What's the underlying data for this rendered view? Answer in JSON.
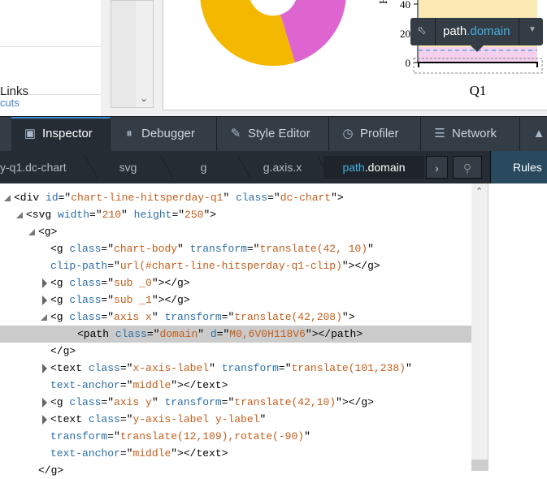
{
  "page": {
    "links_label": "Links",
    "shortcuts_label": "cuts",
    "chart": {
      "y_ticks": [
        "40",
        "20",
        "0"
      ],
      "x_label": "Q1",
      "y_label_fragment": "H"
    },
    "highlighter": {
      "tag": "path",
      "class": ".domain"
    }
  },
  "toolbar": {
    "tabs": [
      {
        "label": "Inspector",
        "icon": "inspector-icon",
        "selected": true
      },
      {
        "label": "Debugger",
        "icon": "pause-icon"
      },
      {
        "label": "Style Editor",
        "icon": "edit-icon"
      },
      {
        "label": "Profiler",
        "icon": "gauge-icon"
      },
      {
        "label": "Network",
        "icon": "network-icon"
      }
    ]
  },
  "breadcrumbs": [
    {
      "label": "y-q1.dc-chart"
    },
    {
      "label": "svg"
    },
    {
      "label": "g"
    },
    {
      "label": "g.axis.x"
    },
    {
      "tag": "path",
      "class": ".domain",
      "selected": true
    }
  ],
  "sidebar": {
    "rules_tab": "Rules"
  },
  "markup": {
    "lines": [
      {
        "indent": 0,
        "twisty": "open",
        "parts": [
          [
            "t",
            "<div "
          ],
          [
            "a",
            "id"
          ],
          [
            "t",
            "=\""
          ],
          [
            "v",
            "chart-line-hitsperday-q1"
          ],
          [
            "t",
            "\" "
          ],
          [
            "a",
            "class"
          ],
          [
            "t",
            "=\""
          ],
          [
            "v",
            "dc-chart"
          ],
          [
            "t",
            "\">"
          ]
        ]
      },
      {
        "indent": 1,
        "twisty": "open",
        "parts": [
          [
            "t",
            "<svg "
          ],
          [
            "a",
            "width"
          ],
          [
            "t",
            "=\""
          ],
          [
            "v",
            "210"
          ],
          [
            "t",
            "\" "
          ],
          [
            "a",
            "height"
          ],
          [
            "t",
            "=\""
          ],
          [
            "v",
            "250"
          ],
          [
            "t",
            "\">"
          ]
        ]
      },
      {
        "indent": 2,
        "twisty": "open",
        "parts": [
          [
            "t",
            "<g>"
          ]
        ]
      },
      {
        "indent": 3,
        "parts": [
          [
            "t",
            "<g "
          ],
          [
            "a",
            "class"
          ],
          [
            "t",
            "=\""
          ],
          [
            "v",
            "chart-body"
          ],
          [
            "t",
            "\" "
          ],
          [
            "a",
            "transform"
          ],
          [
            "t",
            "=\""
          ],
          [
            "v",
            "translate(42, 10)"
          ],
          [
            "t",
            "\""
          ]
        ]
      },
      {
        "indent": 3,
        "parts": [
          [
            "a",
            "clip-path"
          ],
          [
            "t",
            "=\""
          ],
          [
            "v",
            "url(#chart-line-hitsperday-q1-clip)"
          ],
          [
            "t",
            "\"></g>"
          ]
        ]
      },
      {
        "indent": 3,
        "twisty": "closed",
        "parts": [
          [
            "t",
            "<g "
          ],
          [
            "a",
            "class"
          ],
          [
            "t",
            "=\""
          ],
          [
            "v",
            "sub _0"
          ],
          [
            "t",
            "\"></g>"
          ]
        ]
      },
      {
        "indent": 3,
        "twisty": "closed",
        "parts": [
          [
            "t",
            "<g "
          ],
          [
            "a",
            "class"
          ],
          [
            "t",
            "=\""
          ],
          [
            "v",
            "sub _1"
          ],
          [
            "t",
            "\"></g>"
          ]
        ]
      },
      {
        "indent": 3,
        "twisty": "open",
        "parts": [
          [
            "t",
            "<g "
          ],
          [
            "a",
            "class"
          ],
          [
            "t",
            "=\""
          ],
          [
            "v",
            "axis x"
          ],
          [
            "t",
            "\" "
          ],
          [
            "a",
            "transform"
          ],
          [
            "t",
            "=\""
          ],
          [
            "v",
            "translate(42,208)"
          ],
          [
            "t",
            "\">"
          ]
        ]
      },
      {
        "indent": 4,
        "selected": true,
        "parts": [
          [
            "t",
            "<path "
          ],
          [
            "a",
            "class"
          ],
          [
            "t",
            "=\""
          ],
          [
            "v",
            "domain"
          ],
          [
            "t",
            "\" "
          ],
          [
            "a",
            "d"
          ],
          [
            "t",
            "=\""
          ],
          [
            "v",
            "M0,6V0H118V6"
          ],
          [
            "t",
            "\"></path>"
          ]
        ]
      },
      {
        "indent": 3,
        "parts": [
          [
            "t",
            "</g>"
          ]
        ]
      },
      {
        "indent": 3,
        "twisty": "closed",
        "parts": [
          [
            "t",
            "<text "
          ],
          [
            "a",
            "class"
          ],
          [
            "t",
            "=\""
          ],
          [
            "v",
            "x-axis-label"
          ],
          [
            "t",
            "\" "
          ],
          [
            "a",
            "transform"
          ],
          [
            "t",
            "=\""
          ],
          [
            "v",
            "translate(101,238)"
          ],
          [
            "t",
            "\""
          ]
        ]
      },
      {
        "indent": 3,
        "parts": [
          [
            "a",
            "text-anchor"
          ],
          [
            "t",
            "=\""
          ],
          [
            "v",
            "middle"
          ],
          [
            "t",
            "\"></text>"
          ]
        ]
      },
      {
        "indent": 3,
        "twisty": "closed",
        "parts": [
          [
            "t",
            "<g "
          ],
          [
            "a",
            "class"
          ],
          [
            "t",
            "=\""
          ],
          [
            "v",
            "axis y"
          ],
          [
            "t",
            "\" "
          ],
          [
            "a",
            "transform"
          ],
          [
            "t",
            "=\""
          ],
          [
            "v",
            "translate(42,10)"
          ],
          [
            "t",
            "\"></g>"
          ]
        ]
      },
      {
        "indent": 3,
        "twisty": "closed",
        "parts": [
          [
            "t",
            "<text "
          ],
          [
            "a",
            "class"
          ],
          [
            "t",
            "=\""
          ],
          [
            "v",
            "y-axis-label y-label"
          ],
          [
            "t",
            "\""
          ]
        ]
      },
      {
        "indent": 3,
        "parts": [
          [
            "a",
            "transform"
          ],
          [
            "t",
            "=\""
          ],
          [
            "v",
            "translate(12,109),rotate(-90)"
          ],
          [
            "t",
            "\""
          ]
        ]
      },
      {
        "indent": 3,
        "parts": [
          [
            "a",
            "text-anchor"
          ],
          [
            "t",
            "=\""
          ],
          [
            "v",
            "middle"
          ],
          [
            "t",
            "\"></text>"
          ]
        ]
      },
      {
        "indent": 2,
        "parts": [
          [
            "t",
            "</g>"
          ]
        ]
      }
    ]
  },
  "colors": {
    "donut_orange": "#f5b800",
    "donut_magenta": "#de64d0",
    "area_yellow": "#fbe9b3",
    "area_pink": "#f5d0ee",
    "toolbar_bg": "#343c45",
    "accent_blue": "#3a8dd6"
  }
}
